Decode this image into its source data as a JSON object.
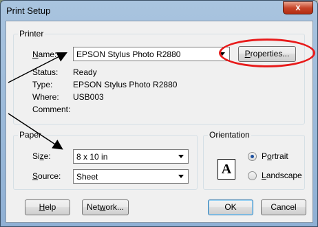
{
  "window": {
    "title": "Print Setup",
    "close_glyph": "x"
  },
  "printer": {
    "group_label": "Printer",
    "name_label": "Name:",
    "name_value": "EPSON Stylus Photo R2880",
    "properties_label": "Properties...",
    "status_label": "Status:",
    "status_value": "Ready",
    "type_label": "Type:",
    "type_value": "EPSON Stylus Photo R2880",
    "where_label": "Where:",
    "where_value": "USB003",
    "comment_label": "Comment:"
  },
  "paper": {
    "group_label": "Paper",
    "size_label": "Size:",
    "size_value": "8 x 10 in",
    "source_label": "Source:",
    "source_value": "Sheet"
  },
  "orientation": {
    "group_label": "Orientation",
    "icon_glyph": "A",
    "portrait_label": "Portrait",
    "landscape_label": "Landscape",
    "selected": "Portrait"
  },
  "buttons": {
    "help": "Help",
    "network": "Network...",
    "ok": "OK",
    "cancel": "Cancel"
  },
  "annotation_color": "#e81a1a"
}
